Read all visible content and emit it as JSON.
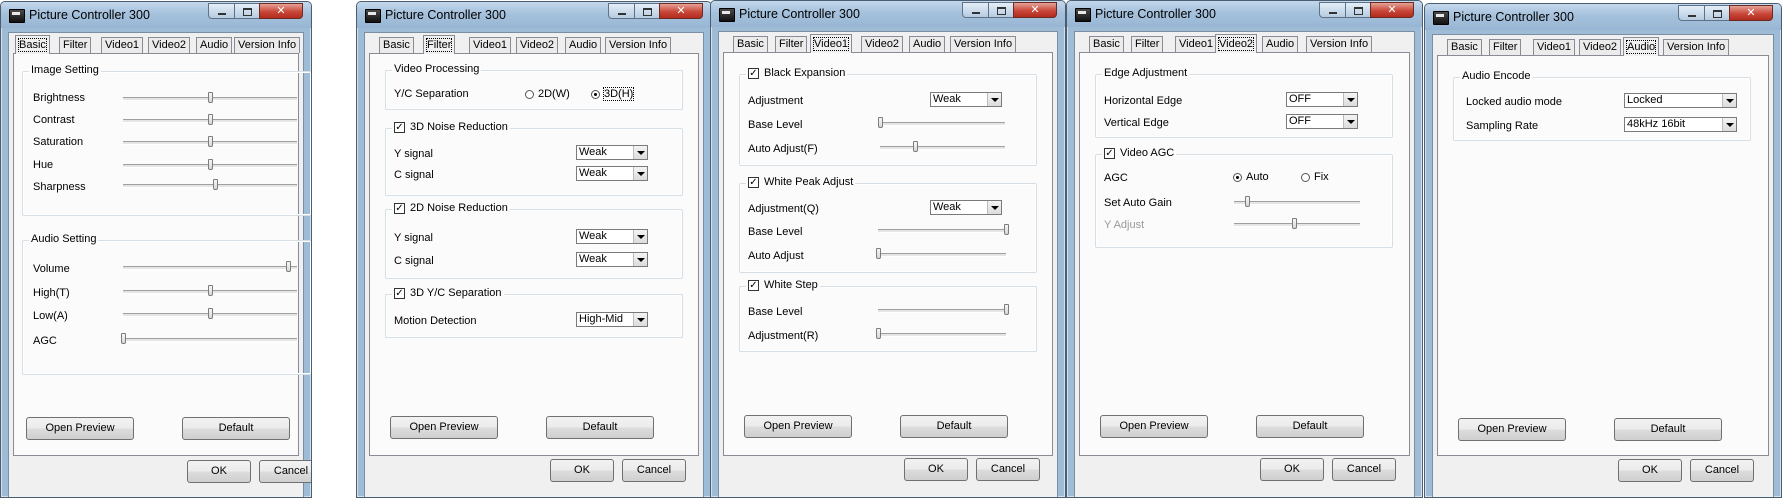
{
  "windows": [
    {
      "title": "Picture Controller 300",
      "tabs": [
        "Basic",
        "Filter",
        "Video1",
        "Video2",
        "Audio",
        "Version Info"
      ],
      "active_tab": "Basic",
      "groups": [
        {
          "title": "Image Setting",
          "rows": [
            {
              "label": "Brightness",
              "level": 0.5
            },
            {
              "label": "Contrast",
              "level": 0.5
            },
            {
              "label": "Saturation",
              "level": 0.5
            },
            {
              "label": "Hue",
              "level": 0.5
            },
            {
              "label": "Sharpness",
              "level": 0.53
            }
          ]
        },
        {
          "title": "Audio Setting",
          "rows": [
            {
              "label": "Volume",
              "level": 0.95
            },
            {
              "label": "High(T)",
              "level": 0.5
            },
            {
              "label": "Low(A)",
              "level": 0.5
            },
            {
              "label": "AGC",
              "level": 0.0
            }
          ]
        }
      ],
      "buttons": {
        "preview": "Open Preview",
        "default": "Default",
        "ok": "OK",
        "cancel": "Cancel"
      }
    },
    {
      "title": "Picture Controller 300",
      "tabs": [
        "Basic",
        "Filter",
        "Video1",
        "Video2",
        "Audio",
        "Version Info"
      ],
      "active_tab": "Filter",
      "groups": [
        {
          "title": "Video Processing",
          "yc_label": "Y/C Separation",
          "options": [
            {
              "label": "2D(W)",
              "selected": false
            },
            {
              "label": "3D(H)",
              "selected": true
            }
          ]
        },
        {
          "title": "3D Noise Reduction",
          "checked": true,
          "rows": [
            {
              "label": "Y signal",
              "value": "Weak"
            },
            {
              "label": "C signal",
              "value": "Weak"
            }
          ]
        },
        {
          "title": "2D Noise Reduction",
          "checked": true,
          "rows": [
            {
              "label": "Y signal",
              "value": "Weak"
            },
            {
              "label": "C signal",
              "value": "Weak"
            }
          ]
        },
        {
          "title": "3D Y/C Separation",
          "checked": true,
          "rows": [
            {
              "label": "Motion Detection",
              "value": "High-Mid"
            }
          ]
        }
      ],
      "buttons": {
        "preview": "Open Preview",
        "default": "Default",
        "ok": "OK",
        "cancel": "Cancel"
      }
    },
    {
      "title": "Picture Controller 300",
      "tabs": [
        "Basic",
        "Filter",
        "Video1",
        "Video2",
        "Audio",
        "Version Info"
      ],
      "active_tab": "Video1",
      "groups": [
        {
          "title": "Black Expansion",
          "checked": true,
          "rows": [
            {
              "label": "Adjustment",
              "value": "Weak"
            },
            {
              "label": "Base Level",
              "level": 0.0
            },
            {
              "label": "Auto Adjust(F)",
              "level": 0.28
            }
          ]
        },
        {
          "title": "White Peak Adjust",
          "checked": true,
          "rows": [
            {
              "label": "Adjustment(Q)",
              "value": "Weak"
            },
            {
              "label": "Base Level",
              "level": 1.0
            },
            {
              "label": "Auto Adjust",
              "level": 0.0
            }
          ]
        },
        {
          "title": "White Step",
          "checked": true,
          "rows": [
            {
              "label": "Base Level",
              "level": 1.0
            },
            {
              "label": "Adjustment(R)",
              "level": 0.0
            }
          ]
        }
      ],
      "buttons": {
        "preview": "Open Preview",
        "default": "Default",
        "ok": "OK",
        "cancel": "Cancel"
      }
    },
    {
      "title": "Picture Controller 300",
      "tabs": [
        "Basic",
        "Filter",
        "Video1",
        "Video2",
        "Audio",
        "Version Info"
      ],
      "active_tab": "Video2",
      "groups": [
        {
          "title": "Edge Adjustment",
          "rows": [
            {
              "label": "Horizontal Edge",
              "value": "OFF"
            },
            {
              "label": "Vertical Edge",
              "value": "OFF"
            }
          ]
        },
        {
          "title": "Video AGC",
          "checked": true,
          "agc_label": "AGC",
          "options": [
            {
              "label": "Auto",
              "selected": true
            },
            {
              "label": "Fix",
              "selected": false
            }
          ],
          "rows": [
            {
              "label": "Set Auto Gain",
              "level": 0.1
            },
            {
              "label": "Y Adjust",
              "level": 0.48,
              "disabled": true
            }
          ]
        }
      ],
      "buttons": {
        "preview": "Open Preview",
        "default": "Default",
        "ok": "OK",
        "cancel": "Cancel"
      }
    },
    {
      "title": "Picture Controller 300",
      "tabs": [
        "Basic",
        "Filter",
        "Video1",
        "Video2",
        "Audio",
        "Version Info"
      ],
      "active_tab": "Audio",
      "groups": [
        {
          "title": "Audio Encode",
          "rows": [
            {
              "label": "Locked audio mode",
              "value": "Locked"
            },
            {
              "label": "Sampling Rate",
              "value": "48kHz 16bit"
            }
          ]
        }
      ],
      "buttons": {
        "preview": "Open Preview",
        "default": "Default",
        "ok": "OK",
        "cancel": "Cancel"
      }
    }
  ]
}
